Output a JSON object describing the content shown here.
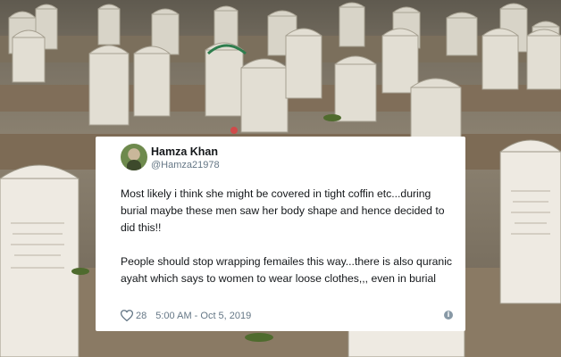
{
  "tweet": {
    "display_name": "Hamza Khan",
    "handle": "@Hamza21978",
    "paragraphs": [
      "Most likely i think she might be covered in tight coffin etc...during burial maybe these men saw her body shape and hence decided to did this!!",
      "People should stop wrapping femailes this way...there is also quranic ayaht which says to women to wear loose clothes,,, even in burial"
    ],
    "likes": "28",
    "timestamp": "5:00 AM - Oct 5, 2019",
    "icons": {
      "like": "heart-outline-icon",
      "info": "info-icon"
    }
  },
  "colors": {
    "text": "#14171a",
    "secondary": "#657786",
    "card": "#ffffff"
  }
}
